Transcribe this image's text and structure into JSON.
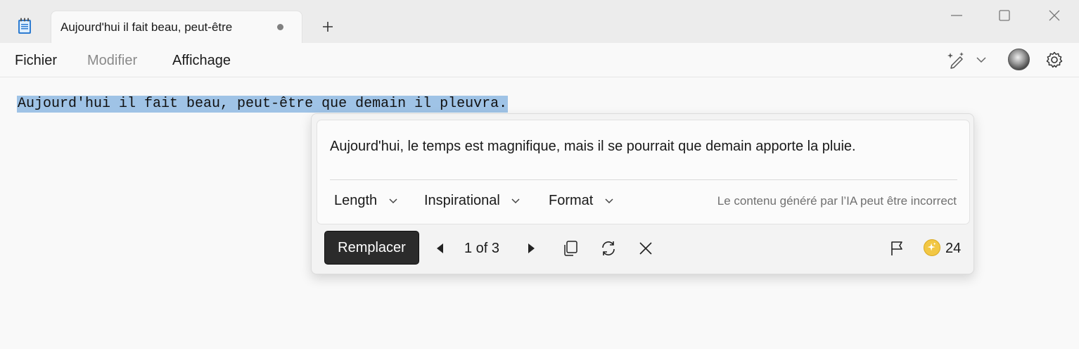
{
  "tab": {
    "title": "Aujourd'hui il fait beau, peut-être"
  },
  "menu": {
    "file": "Fichier",
    "edit": "Modifier",
    "view": "Affichage"
  },
  "editor": {
    "text": "Aujourd'hui il fait beau, peut-être que demain il pleuvra."
  },
  "rewrite": {
    "suggestion": "Aujourd'hui, le temps est magnifique, mais il se pourrait que demain apporte la pluie.",
    "options": {
      "length": "Length",
      "tone": "Inspirational",
      "format": "Format"
    },
    "disclaimer": "Le contenu généré par l’IA peut être incorrect",
    "replace_label": "Remplacer",
    "counter": "1 of 3",
    "credits": "24"
  },
  "icons": {
    "app": "notepad-icon",
    "add": "plus-icon",
    "minimize": "minimize-icon",
    "maximize": "maximize-icon",
    "close": "close-icon",
    "ai": "copilot-rewrite-icon",
    "settings": "gear-icon",
    "prev": "triangle-left-icon",
    "next": "triangle-right-icon",
    "copy": "copy-icon",
    "regenerate": "refresh-icon",
    "dismiss": "close-icon",
    "flag": "flag-icon",
    "credits": "sparkle-coin-icon"
  },
  "colors": {
    "selection": "#9fc3e6",
    "replace_button": "#2b2b2b",
    "coin": "#f2c744"
  }
}
